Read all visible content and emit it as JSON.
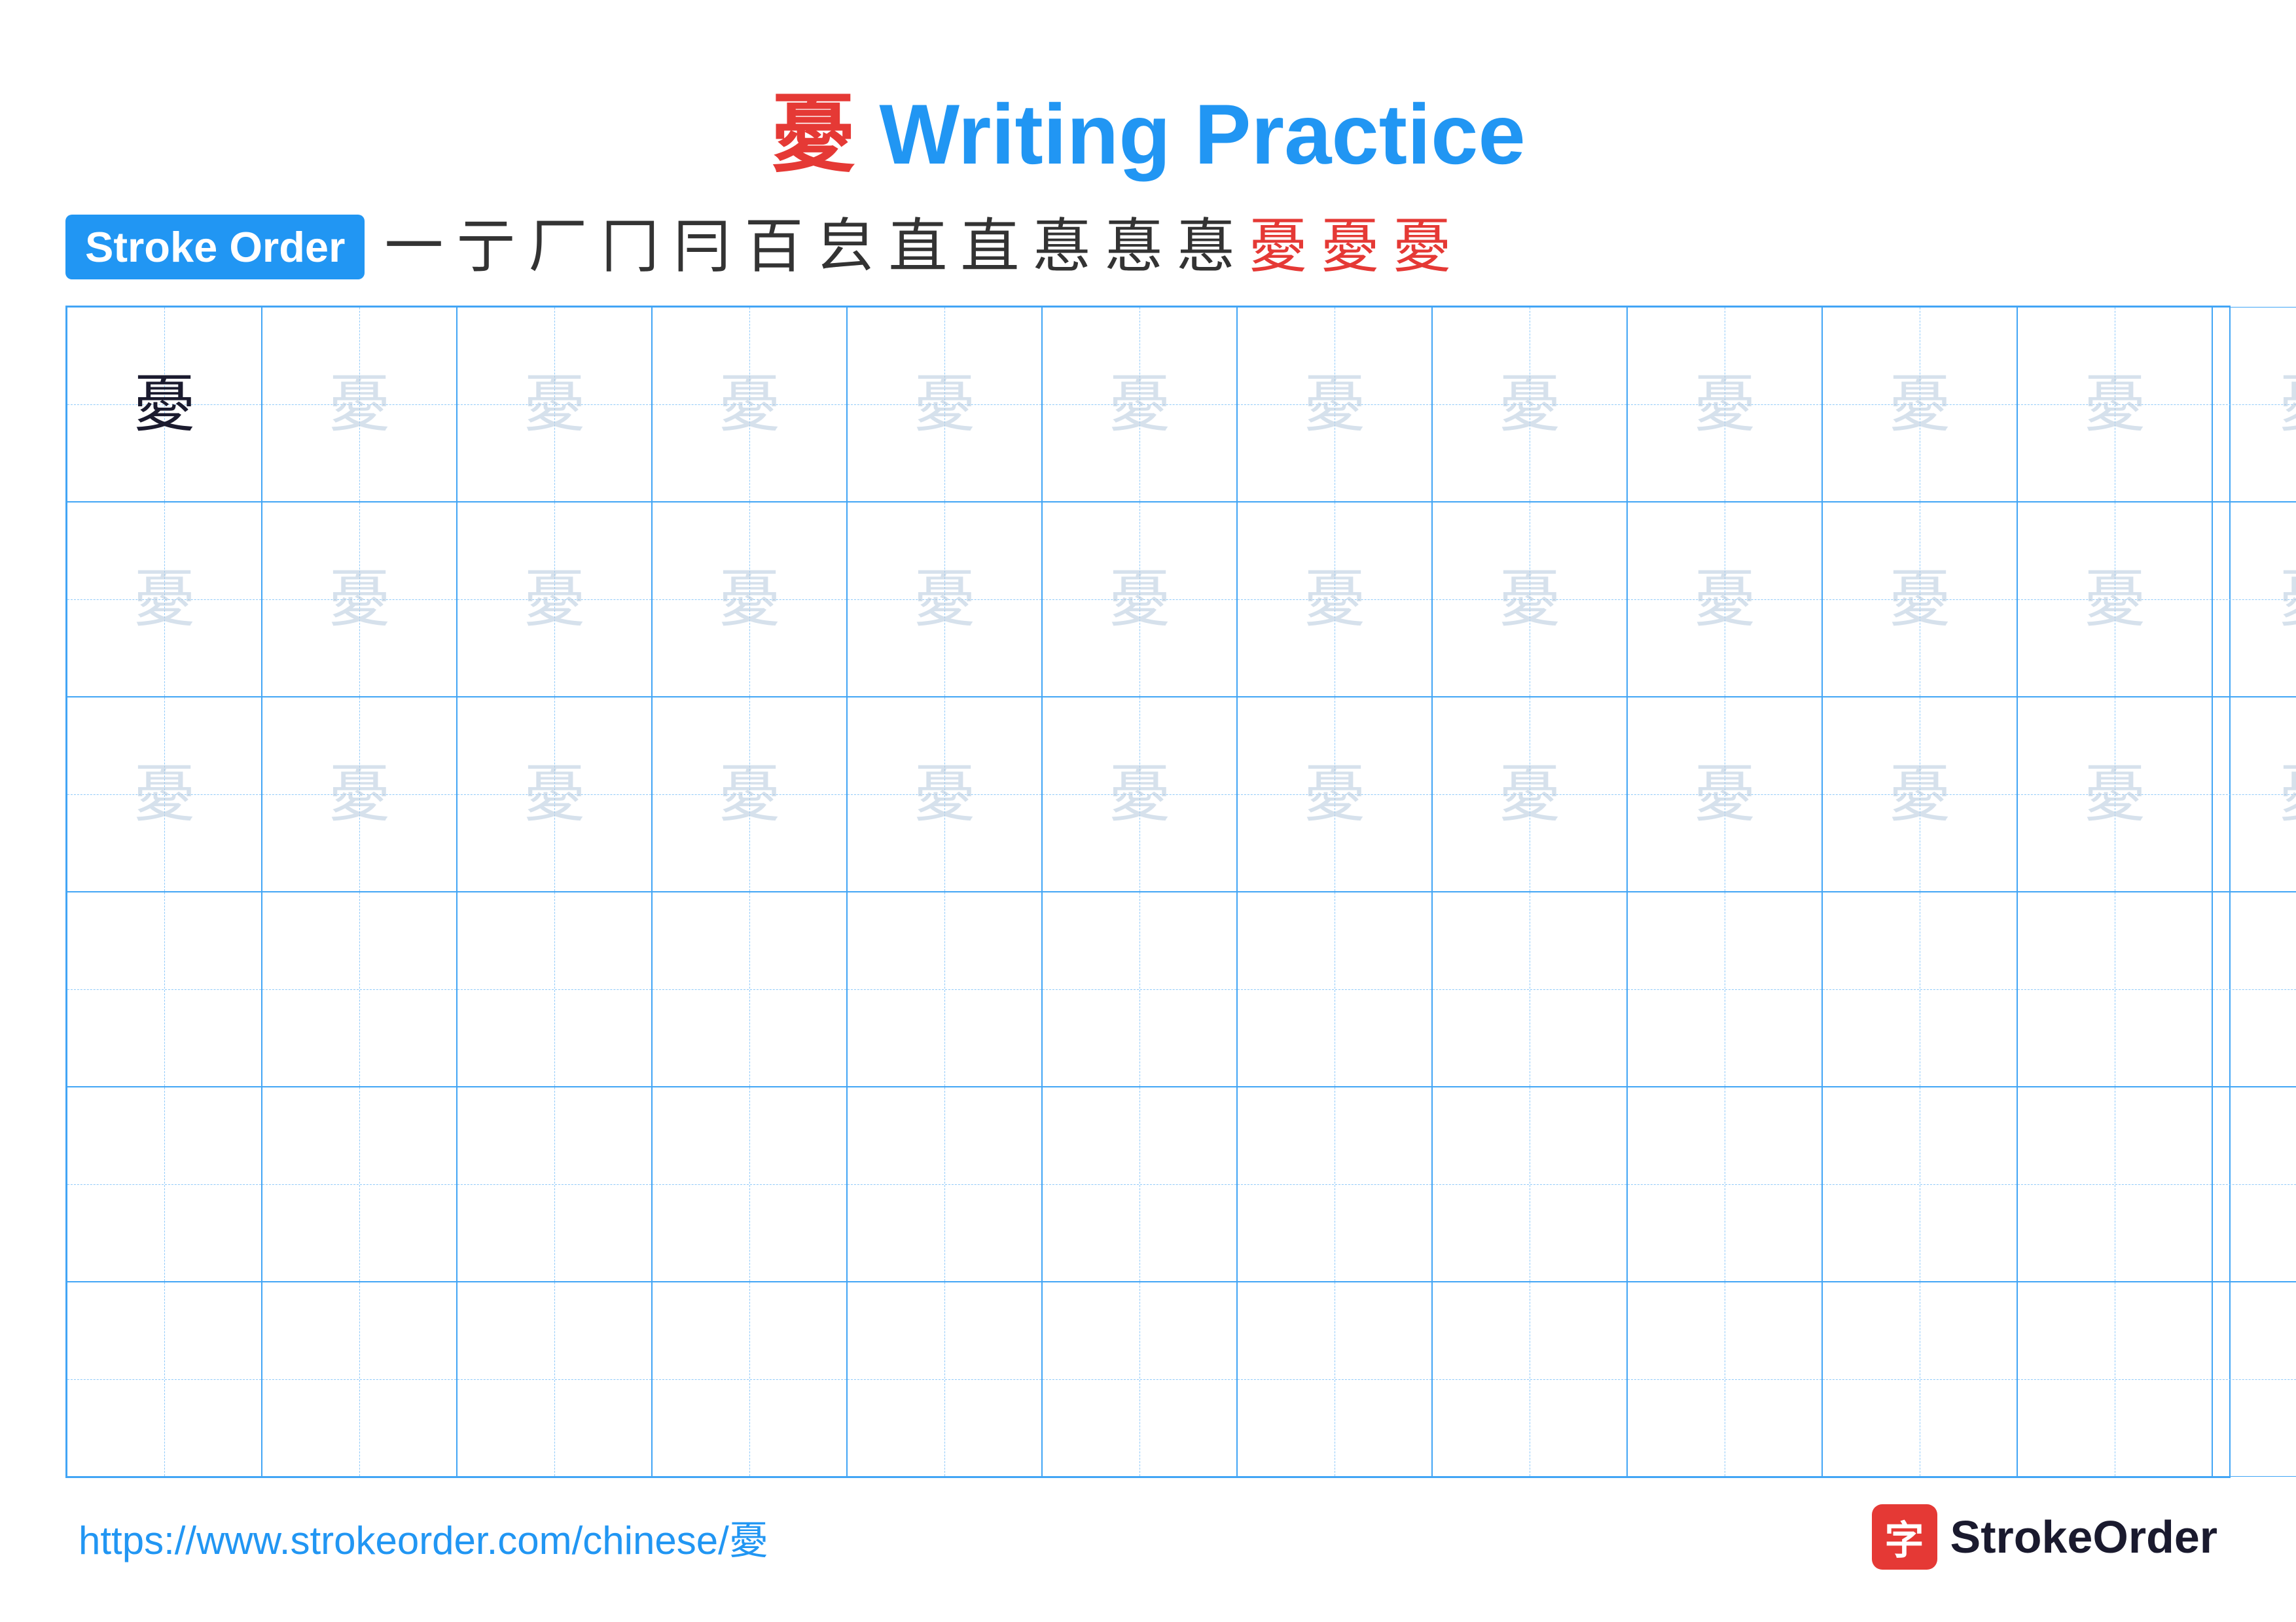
{
  "title": {
    "char": "憂",
    "label": " Writing Practice",
    "full": "憂 Writing Practice"
  },
  "stroke_order": {
    "badge_label": "Stroke Order",
    "strokes": [
      "一",
      "ㄧ",
      "厂",
      "冂",
      "冃",
      "百",
      "百",
      "直",
      "直",
      "惪",
      "惪",
      "惪",
      "憂",
      "憂",
      "憂"
    ]
  },
  "grid": {
    "cols": 13,
    "rows": 6,
    "character": "憂",
    "dark_cells": [
      0
    ],
    "light_rows": [
      0,
      1,
      2
    ]
  },
  "footer": {
    "url": "https://www.strokeorder.com/chinese/憂",
    "logo_text": "StrokeOrder",
    "logo_icon": "字"
  }
}
